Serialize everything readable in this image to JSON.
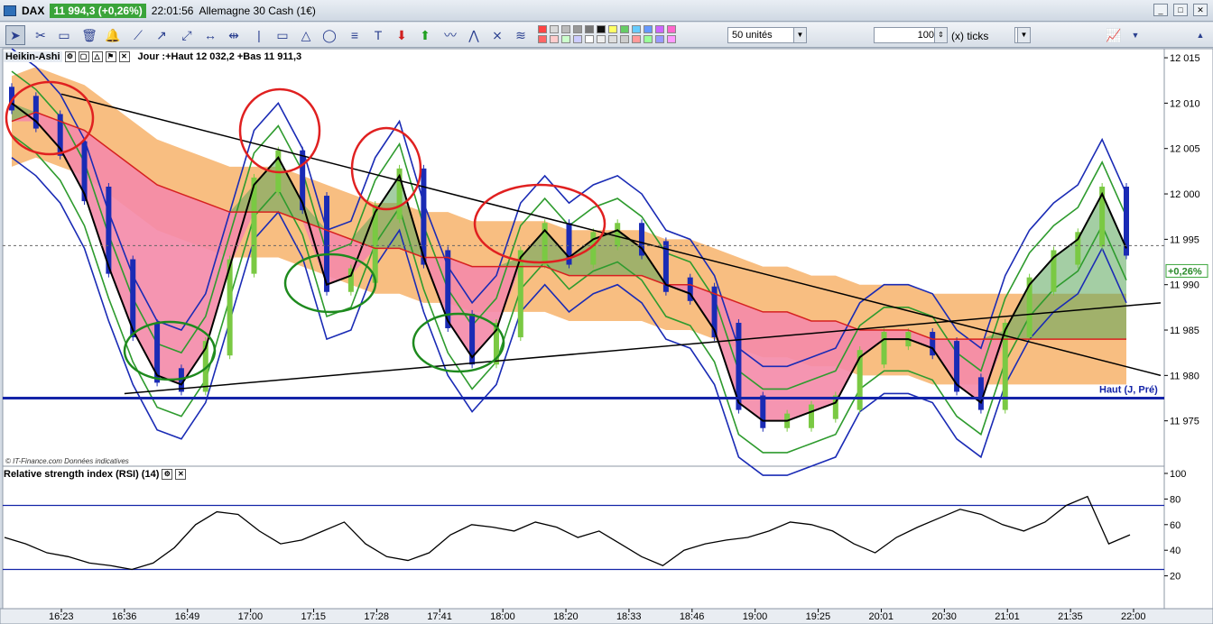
{
  "window": {
    "symbol": "DAX",
    "price_badge": "11 994,3 (+0,26%)",
    "time": "22:01:56",
    "instrument": "Allemagne 30 Cash (1€)"
  },
  "toolbar": {
    "units_select": "50 unités",
    "ticks_value": "100",
    "ticks_label": "(x) ticks",
    "swatch_colors": [
      "#ff4444",
      "#d9d9d9",
      "#bbbbbb",
      "#999999",
      "#777777",
      "#111111",
      "#ffff66",
      "#66cc66",
      "#66ccff",
      "#6699ff",
      "#cc66ff",
      "#ff66cc",
      "#ff6666",
      "#ffcccc",
      "#ccffcc",
      "#ccccff",
      "#ffffff",
      "#eeeeee",
      "#dddddd",
      "#cccccc",
      "#ff9999",
      "#99ff99",
      "#9999ff",
      "#ff99ff"
    ]
  },
  "main_panel": {
    "indicator_name": "Heikin-Ashi",
    "info": "Jour :+Haut 12 032,2 +Bas 11 911,3",
    "source": "© IT-Finance.com Données indicatives",
    "last_change_badge": "+0,26%",
    "level_label": "Haut (J, Pré)"
  },
  "rsi_panel": {
    "title": "Relative strength index (RSI) (14)"
  },
  "colors": {
    "background": "#ffffff",
    "bull_candle": "#7ac943",
    "bear_candle": "#1a2bb5",
    "bollinger_outer": "#1a2bb5",
    "bollinger_inner": "#2e9b2e",
    "cloud_orange": "#f7b36b",
    "cloud_pink": "#f48aa8",
    "cloud_green": "#5aa55a",
    "ma_red": "#d62020",
    "level_blue": "#1424a8",
    "circle_red": "#e02020",
    "circle_green": "#1e8a1e"
  },
  "chart_data": [
    {
      "type": "candlestick",
      "title": "DAX Heikin-Ashi",
      "ylim": [
        11970,
        12016
      ],
      "y_ticks": [
        "12 015",
        "12 010",
        "12 005",
        "12 000",
        "11 995",
        "11 990",
        "11 985",
        "11 980",
        "11 975"
      ],
      "x_ticks": [
        "16:23",
        "16:36",
        "16:49",
        "17:00",
        "17:15",
        "17:28",
        "17:41",
        "18:00",
        "18:20",
        "18:33",
        "18:46",
        "19:00",
        "19:25",
        "20:01",
        "20:30",
        "21:01",
        "21:35",
        "22:00"
      ],
      "series": [
        {
          "name": "Heikin-Ashi close",
          "values": [
            12010,
            12008,
            12005,
            12000,
            11992,
            11985,
            11980,
            11979,
            11983,
            11992,
            12001,
            12004,
            11999,
            11990,
            11991,
            11998,
            12002,
            11993,
            11986,
            11982,
            11985,
            11993,
            11996,
            11993,
            11995,
            11996,
            11994,
            11990,
            11989,
            11985,
            11977,
            11975,
            11975,
            11976,
            11977,
            11982,
            11984,
            11984,
            11983,
            11979,
            11977,
            11985,
            11990,
            11993,
            11995,
            12000,
            11994
          ]
        },
        {
          "name": "MA",
          "values": [
            12008,
            12009,
            12008,
            12007,
            12005,
            12003,
            12001,
            12000,
            11999,
            11998,
            11998,
            11998,
            11997,
            11996,
            11995,
            11994,
            11994,
            11993,
            11993,
            11992,
            11992,
            11992,
            11992,
            11991,
            11991,
            11991,
            11991,
            11990,
            11990,
            11989,
            11988,
            11987,
            11987,
            11986,
            11986,
            11985,
            11985,
            11985,
            11984,
            11984,
            11984,
            11984,
            11984,
            11984,
            11984,
            11984,
            11984
          ]
        }
      ],
      "trendlines": [
        {
          "name": "resistance",
          "from": [
            "16:23",
            12011
          ],
          "to": [
            "22:00",
            11980
          ]
        },
        {
          "name": "support",
          "from": [
            "16:36",
            11978
          ],
          "to": [
            "22:00",
            11988
          ]
        }
      ],
      "levels": [
        {
          "name": "Haut (J, Pré)",
          "value": 11977.5
        }
      ],
      "reference_line": 11994.3
    },
    {
      "type": "line",
      "title": "Relative strength index (RSI) (14)",
      "ylim": [
        0,
        100
      ],
      "y_ticks": [
        "100",
        "80",
        "60",
        "40",
        "20"
      ],
      "bands": [
        25,
        75
      ],
      "series": [
        {
          "name": "RSI",
          "values": [
            50,
            45,
            38,
            35,
            30,
            28,
            25,
            30,
            42,
            60,
            70,
            68,
            55,
            45,
            48,
            55,
            62,
            45,
            35,
            32,
            38,
            52,
            60,
            58,
            55,
            62,
            58,
            50,
            55,
            45,
            35,
            28,
            40,
            45,
            48,
            50,
            55,
            62,
            60,
            55,
            45,
            38,
            50,
            58,
            65,
            72,
            68,
            60,
            55,
            62,
            75,
            82,
            45,
            52
          ]
        }
      ]
    }
  ]
}
